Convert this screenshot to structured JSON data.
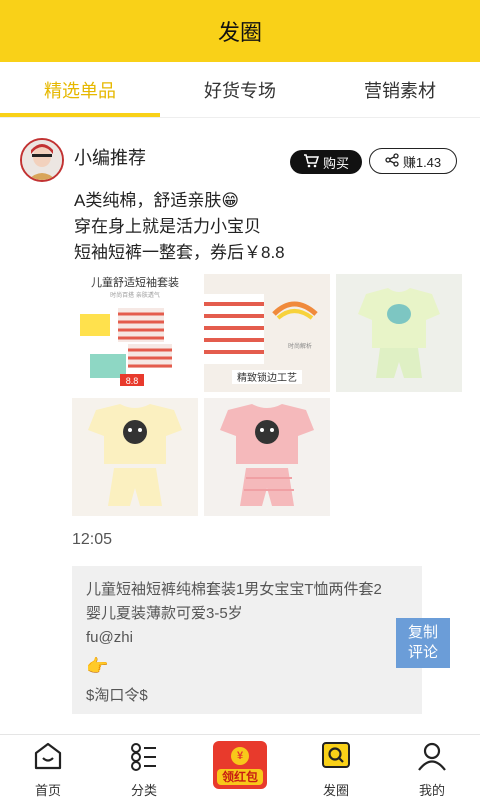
{
  "header": {
    "title": "发圈"
  },
  "tabs": [
    {
      "label": "精选单品",
      "active": true
    },
    {
      "label": "好货专场",
      "active": false
    },
    {
      "label": "营销素材",
      "active": false
    }
  ],
  "post": {
    "author": "小编推荐",
    "buy_label": "购买",
    "share_label": "赚1.43",
    "description": [
      "A类纯棉，舒适亲肤😁",
      "穿在身上就是活力小宝贝",
      "短袖短裤一整套，券后￥8.8"
    ],
    "image_labels": {
      "img1_title": "儿童舒适短袖套装",
      "img1_sub": "时尚百搭 亲肤透气",
      "img1_price": "8.8",
      "img2_sub": "时尚解析",
      "img2_caption": "精致锁边工艺"
    },
    "time": "12:05",
    "copy_text": {
      "line1": "儿童短袖短裤纯棉套装1男女宝宝T恤两件套2",
      "line2": "婴儿夏装薄款可爱3-5岁",
      "line3": "fu@zhi",
      "hand": "👉",
      "line5": "$淘口令$"
    },
    "copy_button": {
      "line1": "复制",
      "line2": "评论"
    }
  },
  "bottom_nav": {
    "home": "首页",
    "category": "分类",
    "redpacket": "领红包",
    "redpacket_coin": "¥",
    "moments": "发圈",
    "mine": "我的"
  },
  "colors": {
    "accent": "#f9d118",
    "active_tab": "#e6b800",
    "copy_button": "#6b9dd8",
    "red_packet": "#e83a2c"
  }
}
